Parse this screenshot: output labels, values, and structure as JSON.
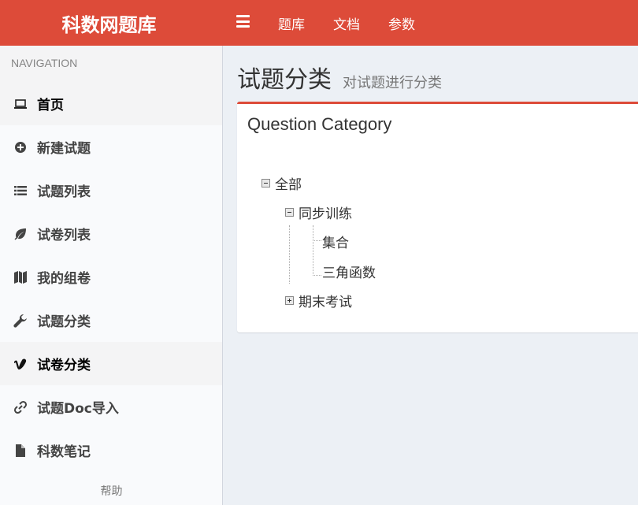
{
  "app": {
    "title": "科数网题库"
  },
  "topnav": {
    "items": [
      "题库",
      "文档",
      "参数"
    ]
  },
  "sidebar": {
    "header": "NAVIGATION",
    "items": [
      {
        "label": "首页",
        "icon": "laptop-icon",
        "active": true
      },
      {
        "label": "新建试题",
        "icon": "plus-circle-icon"
      },
      {
        "label": "试题列表",
        "icon": "list-icon"
      },
      {
        "label": "试卷列表",
        "icon": "leaf-icon"
      },
      {
        "label": "我的组卷",
        "icon": "map-icon"
      },
      {
        "label": "试题分类",
        "icon": "wrench-icon"
      },
      {
        "label": "试卷分类",
        "icon": "vimeo-icon",
        "active": true
      },
      {
        "label": "试题Doc导入",
        "icon": "link-icon"
      },
      {
        "label": "科数笔记",
        "icon": "file-icon"
      }
    ],
    "help": "帮助"
  },
  "page": {
    "title": "试题分类",
    "subtitle": "对试题进行分类"
  },
  "box": {
    "title": "Question Category"
  },
  "tree": {
    "root": "全部",
    "children": [
      {
        "label": "同步训练",
        "children": [
          "集合",
          "三角函数"
        ],
        "expanded": true
      },
      {
        "label": "期末考试",
        "expanded": false
      }
    ]
  },
  "colors": {
    "accent": "#dd4b39",
    "background": "#ecf0f5",
    "sidebar": "#f9fafc"
  }
}
